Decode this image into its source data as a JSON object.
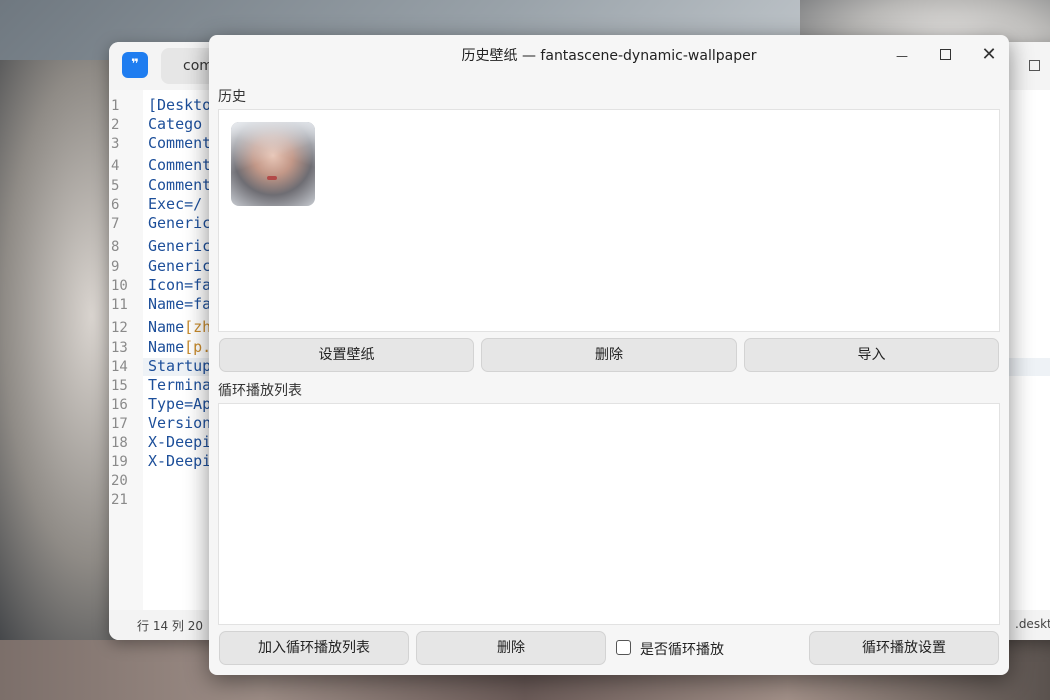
{
  "editor": {
    "tab_label": "com",
    "line_numbers": [
      "1",
      "2",
      "3",
      "4",
      "5",
      "6",
      "7",
      "8",
      "9",
      "10",
      "11",
      "12",
      "13",
      "14",
      "15",
      "16",
      "17",
      "18",
      "19",
      "20",
      "21"
    ],
    "lines": [
      {
        "text": "[Deskto",
        "hl": ""
      },
      {
        "text": "Catego",
        "hl": ""
      },
      {
        "text": "Comment",
        "hl": ""
      },
      {
        "text": "Comment",
        "hl": ""
      },
      {
        "text": "Comment",
        "hl": ""
      },
      {
        "text": "Exec=/",
        "hl": ""
      },
      {
        "text": "Generic",
        "hl": ""
      },
      {
        "text": "Generic",
        "hl": ""
      },
      {
        "text": "Generic",
        "hl": ""
      },
      {
        "text": "Icon=fa",
        "hl": ""
      },
      {
        "text": "Name=fa",
        "hl": ""
      },
      {
        "text": "Name",
        "hl": "[zh"
      },
      {
        "text": "Name",
        "hl": "[p."
      },
      {
        "text": "Startup",
        "hl": ""
      },
      {
        "text": "Termina",
        "hl": ""
      },
      {
        "text": "Type=Ap",
        "hl": ""
      },
      {
        "text": "Version",
        "hl": ""
      },
      {
        "text": "X-Deepi",
        "hl": ""
      },
      {
        "text": "X-Deepi",
        "hl": ""
      },
      {
        "text": "",
        "hl": ""
      },
      {
        "text": "",
        "hl": ""
      }
    ],
    "status_position": "行 14  列 20",
    "status_ext": ".deskto"
  },
  "dialog": {
    "title": "历史壁纸 — fantascene-dynamic-wallpaper",
    "history_label": "历史",
    "set_wallpaper": "设置壁纸",
    "delete_history": "删除",
    "import": "导入",
    "playlist_label": "循环播放列表",
    "add_to_playlist": "加入循环播放列表",
    "delete_playlist": "删除",
    "loop_checkbox_label": "是否循环播放",
    "loop_checked": false,
    "loop_settings": "循环播放设置",
    "close_glyph": "✕",
    "minimize_glyph": "—"
  }
}
